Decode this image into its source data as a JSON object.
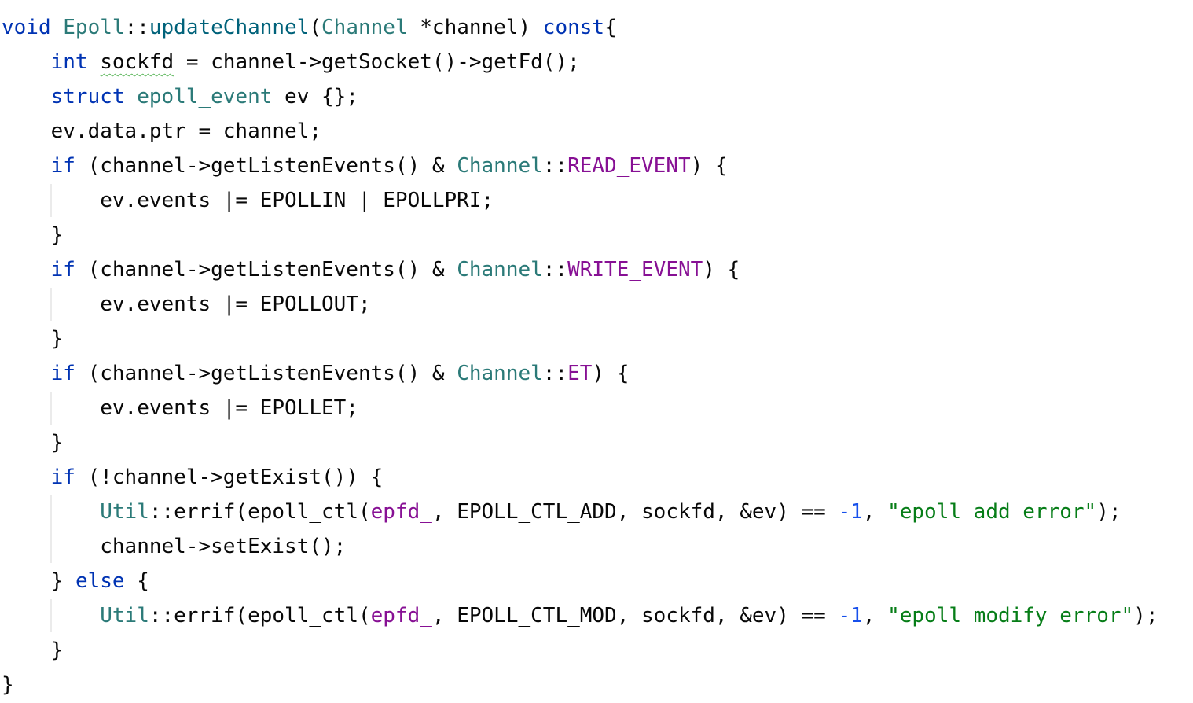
{
  "colors": {
    "keyword": "#0033b3",
    "type": "#2b7a78",
    "member": "#871094",
    "number": "#1750eb",
    "string": "#067d17",
    "text": "#080808",
    "background": "#ffffff",
    "indent_guide": "#ebebeb"
  },
  "code": {
    "lines": [
      {
        "indent": "",
        "tokens": [
          {
            "t": "void",
            "k": "kw"
          },
          {
            "t": " ",
            "k": "plain"
          },
          {
            "t": "Epoll",
            "k": "type"
          },
          {
            "t": "::",
            "k": "plain"
          },
          {
            "t": "updateChannel",
            "k": "fn"
          },
          {
            "t": "(",
            "k": "plain"
          },
          {
            "t": "Channel",
            "k": "type"
          },
          {
            "t": " *channel) ",
            "k": "plain"
          },
          {
            "t": "const",
            "k": "kw"
          },
          {
            "t": "{",
            "k": "plain"
          }
        ]
      },
      {
        "indent": "    ",
        "tokens": [
          {
            "t": "int",
            "k": "kw"
          },
          {
            "t": " ",
            "k": "plain"
          },
          {
            "t": "sockfd",
            "k": "squiggle"
          },
          {
            "t": " = channel->getSocket()->getFd();",
            "k": "plain"
          }
        ]
      },
      {
        "indent": "    ",
        "tokens": [
          {
            "t": "struct",
            "k": "kw"
          },
          {
            "t": " ",
            "k": "plain"
          },
          {
            "t": "epoll_event",
            "k": "type"
          },
          {
            "t": " ev {};",
            "k": "plain"
          }
        ]
      },
      {
        "indent": "    ",
        "tokens": [
          {
            "t": "ev.data.ptr = channel;",
            "k": "plain"
          }
        ]
      },
      {
        "indent": "    ",
        "tokens": [
          {
            "t": "if",
            "k": "kw"
          },
          {
            "t": " (channel->getListenEvents() & ",
            "k": "plain"
          },
          {
            "t": "Channel",
            "k": "type"
          },
          {
            "t": "::",
            "k": "plain"
          },
          {
            "t": "READ_EVENT",
            "k": "mem"
          },
          {
            "t": ") {",
            "k": "plain"
          }
        ]
      },
      {
        "indent": "        ",
        "tokens": [
          {
            "t": "ev.events |= EPOLLIN | EPOLLPRI;",
            "k": "plain"
          }
        ]
      },
      {
        "indent": "    ",
        "tokens": [
          {
            "t": "}",
            "k": "plain"
          }
        ]
      },
      {
        "indent": "    ",
        "tokens": [
          {
            "t": "if",
            "k": "kw"
          },
          {
            "t": " (channel->getListenEvents() & ",
            "k": "plain"
          },
          {
            "t": "Channel",
            "k": "type"
          },
          {
            "t": "::",
            "k": "plain"
          },
          {
            "t": "WRITE_EVENT",
            "k": "mem"
          },
          {
            "t": ") {",
            "k": "plain"
          }
        ]
      },
      {
        "indent": "        ",
        "tokens": [
          {
            "t": "ev.events |= EPOLLOUT;",
            "k": "plain"
          }
        ]
      },
      {
        "indent": "    ",
        "tokens": [
          {
            "t": "}",
            "k": "plain"
          }
        ]
      },
      {
        "indent": "    ",
        "tokens": [
          {
            "t": "if",
            "k": "kw"
          },
          {
            "t": " (channel->getListenEvents() & ",
            "k": "plain"
          },
          {
            "t": "Channel",
            "k": "type"
          },
          {
            "t": "::",
            "k": "plain"
          },
          {
            "t": "ET",
            "k": "mem"
          },
          {
            "t": ") {",
            "k": "plain"
          }
        ]
      },
      {
        "indent": "        ",
        "tokens": [
          {
            "t": "ev.events |= EPOLLET;",
            "k": "plain"
          }
        ]
      },
      {
        "indent": "    ",
        "tokens": [
          {
            "t": "}",
            "k": "plain"
          }
        ]
      },
      {
        "indent": "    ",
        "tokens": [
          {
            "t": "if",
            "k": "kw"
          },
          {
            "t": " (!channel->getExist()) {",
            "k": "plain"
          }
        ]
      },
      {
        "indent": "        ",
        "tokens": [
          {
            "t": "Util",
            "k": "type"
          },
          {
            "t": "::errif(epoll_ctl(",
            "k": "plain"
          },
          {
            "t": "epfd_",
            "k": "mem"
          },
          {
            "t": ", EPOLL_CTL_ADD, sockfd, &ev) == ",
            "k": "plain"
          },
          {
            "t": "-1",
            "k": "num"
          },
          {
            "t": ", ",
            "k": "plain"
          },
          {
            "t": "\"epoll add error\"",
            "k": "str"
          },
          {
            "t": ");",
            "k": "plain"
          }
        ]
      },
      {
        "indent": "        ",
        "tokens": [
          {
            "t": "channel->setExist();",
            "k": "plain"
          }
        ]
      },
      {
        "indent": "    ",
        "tokens": [
          {
            "t": "} ",
            "k": "plain"
          },
          {
            "t": "else",
            "k": "kw"
          },
          {
            "t": " {",
            "k": "plain"
          }
        ]
      },
      {
        "indent": "        ",
        "tokens": [
          {
            "t": "Util",
            "k": "type"
          },
          {
            "t": "::errif(epoll_ctl(",
            "k": "plain"
          },
          {
            "t": "epfd_",
            "k": "mem"
          },
          {
            "t": ", EPOLL_CTL_MOD, sockfd, &ev) == ",
            "k": "plain"
          },
          {
            "t": "-1",
            "k": "num"
          },
          {
            "t": ", ",
            "k": "plain"
          },
          {
            "t": "\"epoll modify error\"",
            "k": "str"
          },
          {
            "t": ");",
            "k": "plain"
          }
        ]
      },
      {
        "indent": "    ",
        "tokens": [
          {
            "t": "}",
            "k": "plain"
          }
        ]
      },
      {
        "indent": "",
        "tokens": [
          {
            "t": "}",
            "k": "plain"
          }
        ]
      }
    ]
  }
}
